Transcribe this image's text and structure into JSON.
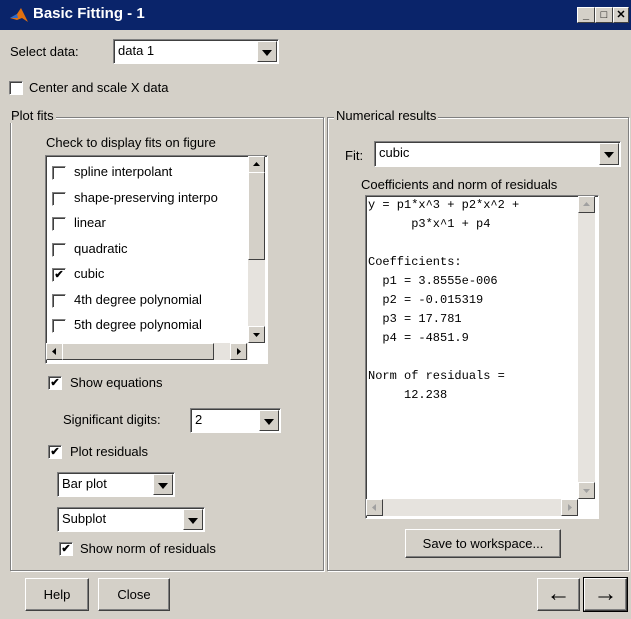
{
  "window": {
    "title": "Basic Fitting - 1"
  },
  "select_data": {
    "label": "Select data:",
    "value": "data 1"
  },
  "center_scale": {
    "label": "Center and scale X data",
    "checked": false
  },
  "plot_fits": {
    "title": "Plot fits",
    "check_label": "Check to display fits on figure",
    "fits": [
      {
        "label": "spline interpolant",
        "checked": false
      },
      {
        "label": "shape-preserving interpo",
        "checked": false
      },
      {
        "label": "linear",
        "checked": false
      },
      {
        "label": "quadratic",
        "checked": false
      },
      {
        "label": "cubic",
        "checked": true
      },
      {
        "label": "4th degree polynomial",
        "checked": false
      },
      {
        "label": "5th degree polynomial",
        "checked": false
      }
    ],
    "show_equations": {
      "label": "Show equations",
      "checked": true
    },
    "significant_digits": {
      "label": "Significant digits:",
      "value": "2"
    },
    "plot_residuals": {
      "label": "Plot residuals",
      "checked": true
    },
    "residual_plot_type": "Bar plot",
    "residual_location": "Subplot",
    "show_norm": {
      "label": "Show norm of residuals",
      "checked": true
    }
  },
  "numerical_results": {
    "title": "Numerical results",
    "fit_label": "Fit:",
    "fit_value": "cubic",
    "coeff_label": "Coefficients and norm of residuals",
    "results_lines": [
      "y = p1*x^3 + p2*x^2 +",
      "      p3*x^1 + p4",
      "",
      "Coefficients:",
      "  p1 = 3.8555e-006",
      "  p2 = -0.015319",
      "  p3 = 17.781",
      "  p4 = -4851.9",
      "",
      "Norm of residuals =",
      "     12.238"
    ],
    "save_button": "Save to workspace..."
  },
  "footer": {
    "help": "Help",
    "close": "Close",
    "back_arrow": "←",
    "forward_arrow": "→"
  },
  "icons": {
    "app": "matlab-logo-icon",
    "check": "✔"
  }
}
